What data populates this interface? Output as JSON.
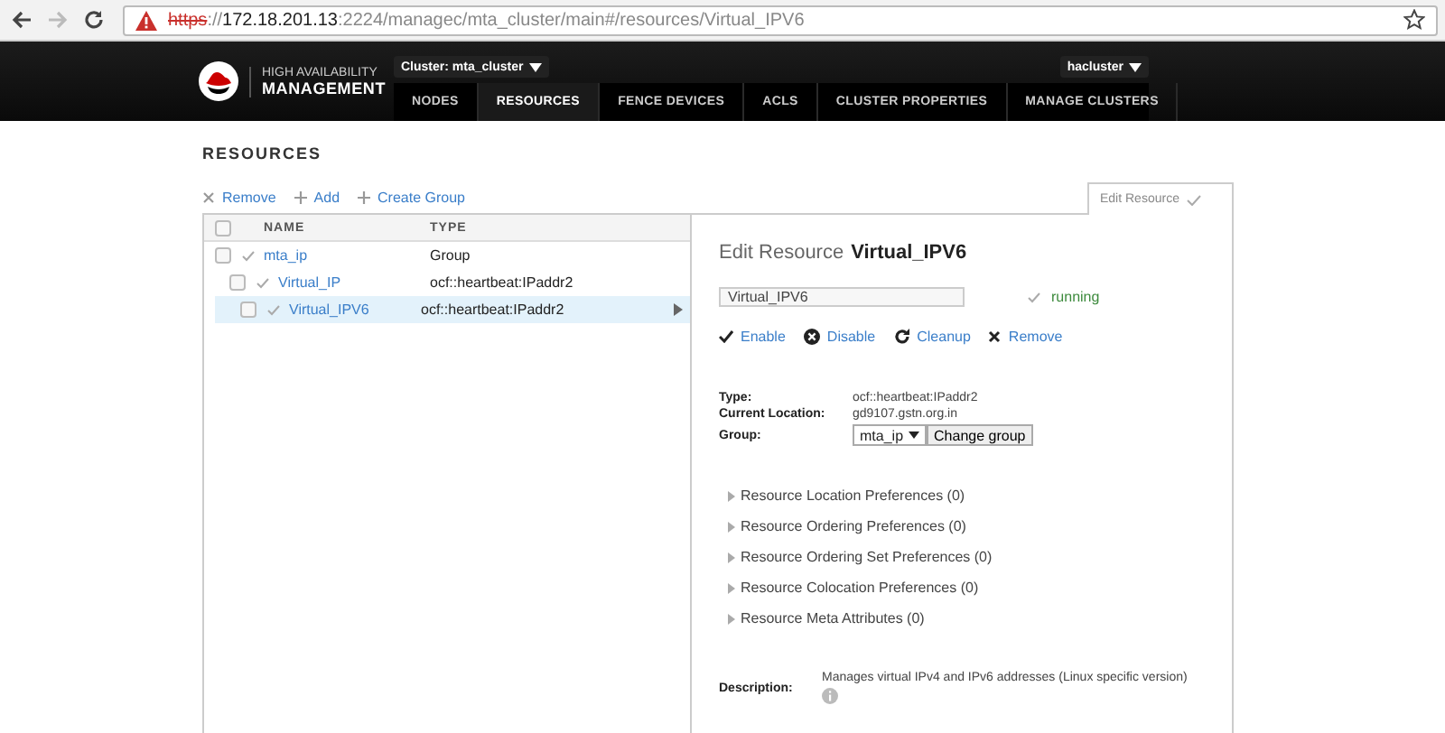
{
  "browser": {
    "url": [
      {
        "text": "https",
        "kind": "insecure"
      },
      {
        "text": "://",
        "kind": "dim"
      },
      {
        "text": "172.18.201.13",
        "kind": "host"
      },
      {
        "text": ":2224/managec/mta_cluster/main#/resources/Virtual_IPV6",
        "kind": "dim"
      }
    ]
  },
  "header": {
    "brand": [
      "HIGH AVAILABILITY",
      "MANAGEMENT"
    ],
    "cluster_menu": "Cluster: mta_cluster",
    "user_menu": "hacluster",
    "tabs": [
      {
        "label": "NODES",
        "selected": false
      },
      {
        "label": "RESOURCES",
        "selected": true
      },
      {
        "label": "FENCE DEVICES",
        "selected": false
      },
      {
        "label": "ACLS",
        "selected": false
      },
      {
        "label": "CLUSTER PROPERTIES",
        "selected": false
      },
      {
        "label": "MANAGE CLUSTERS",
        "selected": false
      }
    ]
  },
  "page_title": "RESOURCES",
  "actions": [
    {
      "label": "Remove",
      "kind": "remove"
    },
    {
      "label": "Add",
      "kind": "add"
    },
    {
      "label": "Create Group",
      "kind": "add"
    }
  ],
  "table": {
    "columns": [
      "NAME",
      "TYPE"
    ],
    "all_checked": false,
    "rows": [
      {
        "name": "mta_ip",
        "type": "Group",
        "checked": false,
        "selected": false,
        "children": [
          {
            "name": "Virtual_IP",
            "type": "ocf::heartbeat:IPaddr2",
            "checked": false,
            "selected": false
          },
          {
            "name": "Virtual_IPV6",
            "type": "ocf::heartbeat:IPaddr2",
            "checked": false,
            "selected": true
          }
        ]
      }
    ]
  },
  "edit_tab": {
    "label": "Edit Resource",
    "selected": true
  },
  "editor": {
    "title_prefix": "Edit Resource",
    "title_name": "Virtual_IPV6",
    "name_value": "Virtual_IPV6",
    "status": "running",
    "actions": [
      {
        "label": "Enable",
        "kind": "enable"
      },
      {
        "label": "Disable",
        "kind": "disable"
      },
      {
        "label": "Cleanup",
        "kind": "cleanup"
      },
      {
        "label": "Remove",
        "kind": "remove"
      }
    ],
    "fields": [
      {
        "label": "Type:",
        "value": "ocf::heartbeat:IPaddr2"
      },
      {
        "label": "Current Location:",
        "value": "gd9107.gstn.org.in"
      }
    ],
    "group": {
      "label": "Group:",
      "value": "mta_ip",
      "button": "Change group"
    },
    "sections": [
      {
        "label": "Resource Location Preferences (0)",
        "expanded": false
      },
      {
        "label": "Resource Ordering Preferences (0)",
        "expanded": false
      },
      {
        "label": "Resource Ordering Set Preferences (0)",
        "expanded": false
      },
      {
        "label": "Resource Colocation Preferences (0)",
        "expanded": false
      },
      {
        "label": "Resource Meta Attributes (0)",
        "expanded": false
      }
    ],
    "description": {
      "label": "Description:",
      "text": "Manages virtual IPv4 and IPv6 addresses (Linux specific version)"
    }
  }
}
